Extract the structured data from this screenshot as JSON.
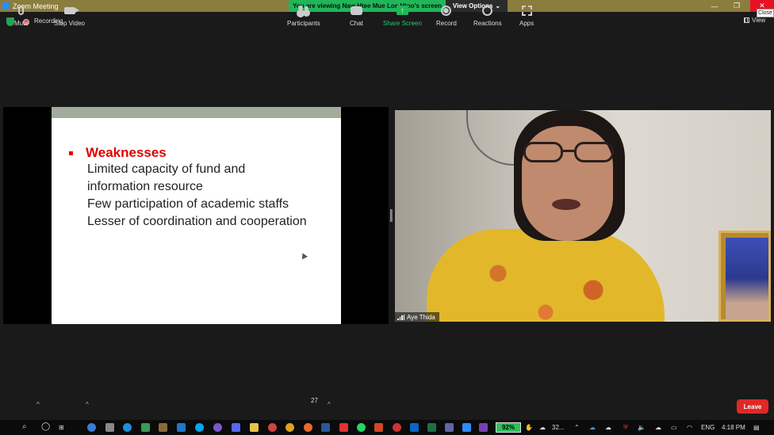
{
  "window": {
    "title": "Zoom Meeting",
    "viewing_banner": "You are viewing Naw Htee Mue Loe Htoo's screen",
    "view_options": "View Options",
    "close_tooltip": "Close"
  },
  "status": {
    "recording_label": "Recording",
    "view_label": "View"
  },
  "slide": {
    "heading": "Weaknesses",
    "lines": [
      "Limited capacity of fund and",
      "information resource",
      "Few participation of academic staffs",
      "Lesser of coordination and cooperation"
    ],
    "heading_color": "#e00000"
  },
  "video": {
    "participant_name": "Aye Thida"
  },
  "toolbar": {
    "mute": "Mute",
    "stop_video": "Stop Video",
    "participants": "Participants",
    "participants_count": "27",
    "chat": "Chat",
    "share_screen": "Share Screen",
    "record": "Record",
    "reactions": "Reactions",
    "apps": "Apps",
    "leave": "Leave",
    "share_color": "#20b659",
    "leave_color": "#e02828"
  },
  "taskbar": {
    "battery": "92%",
    "temp": "32...",
    "language": "ENG",
    "time": "4:18 PM"
  }
}
